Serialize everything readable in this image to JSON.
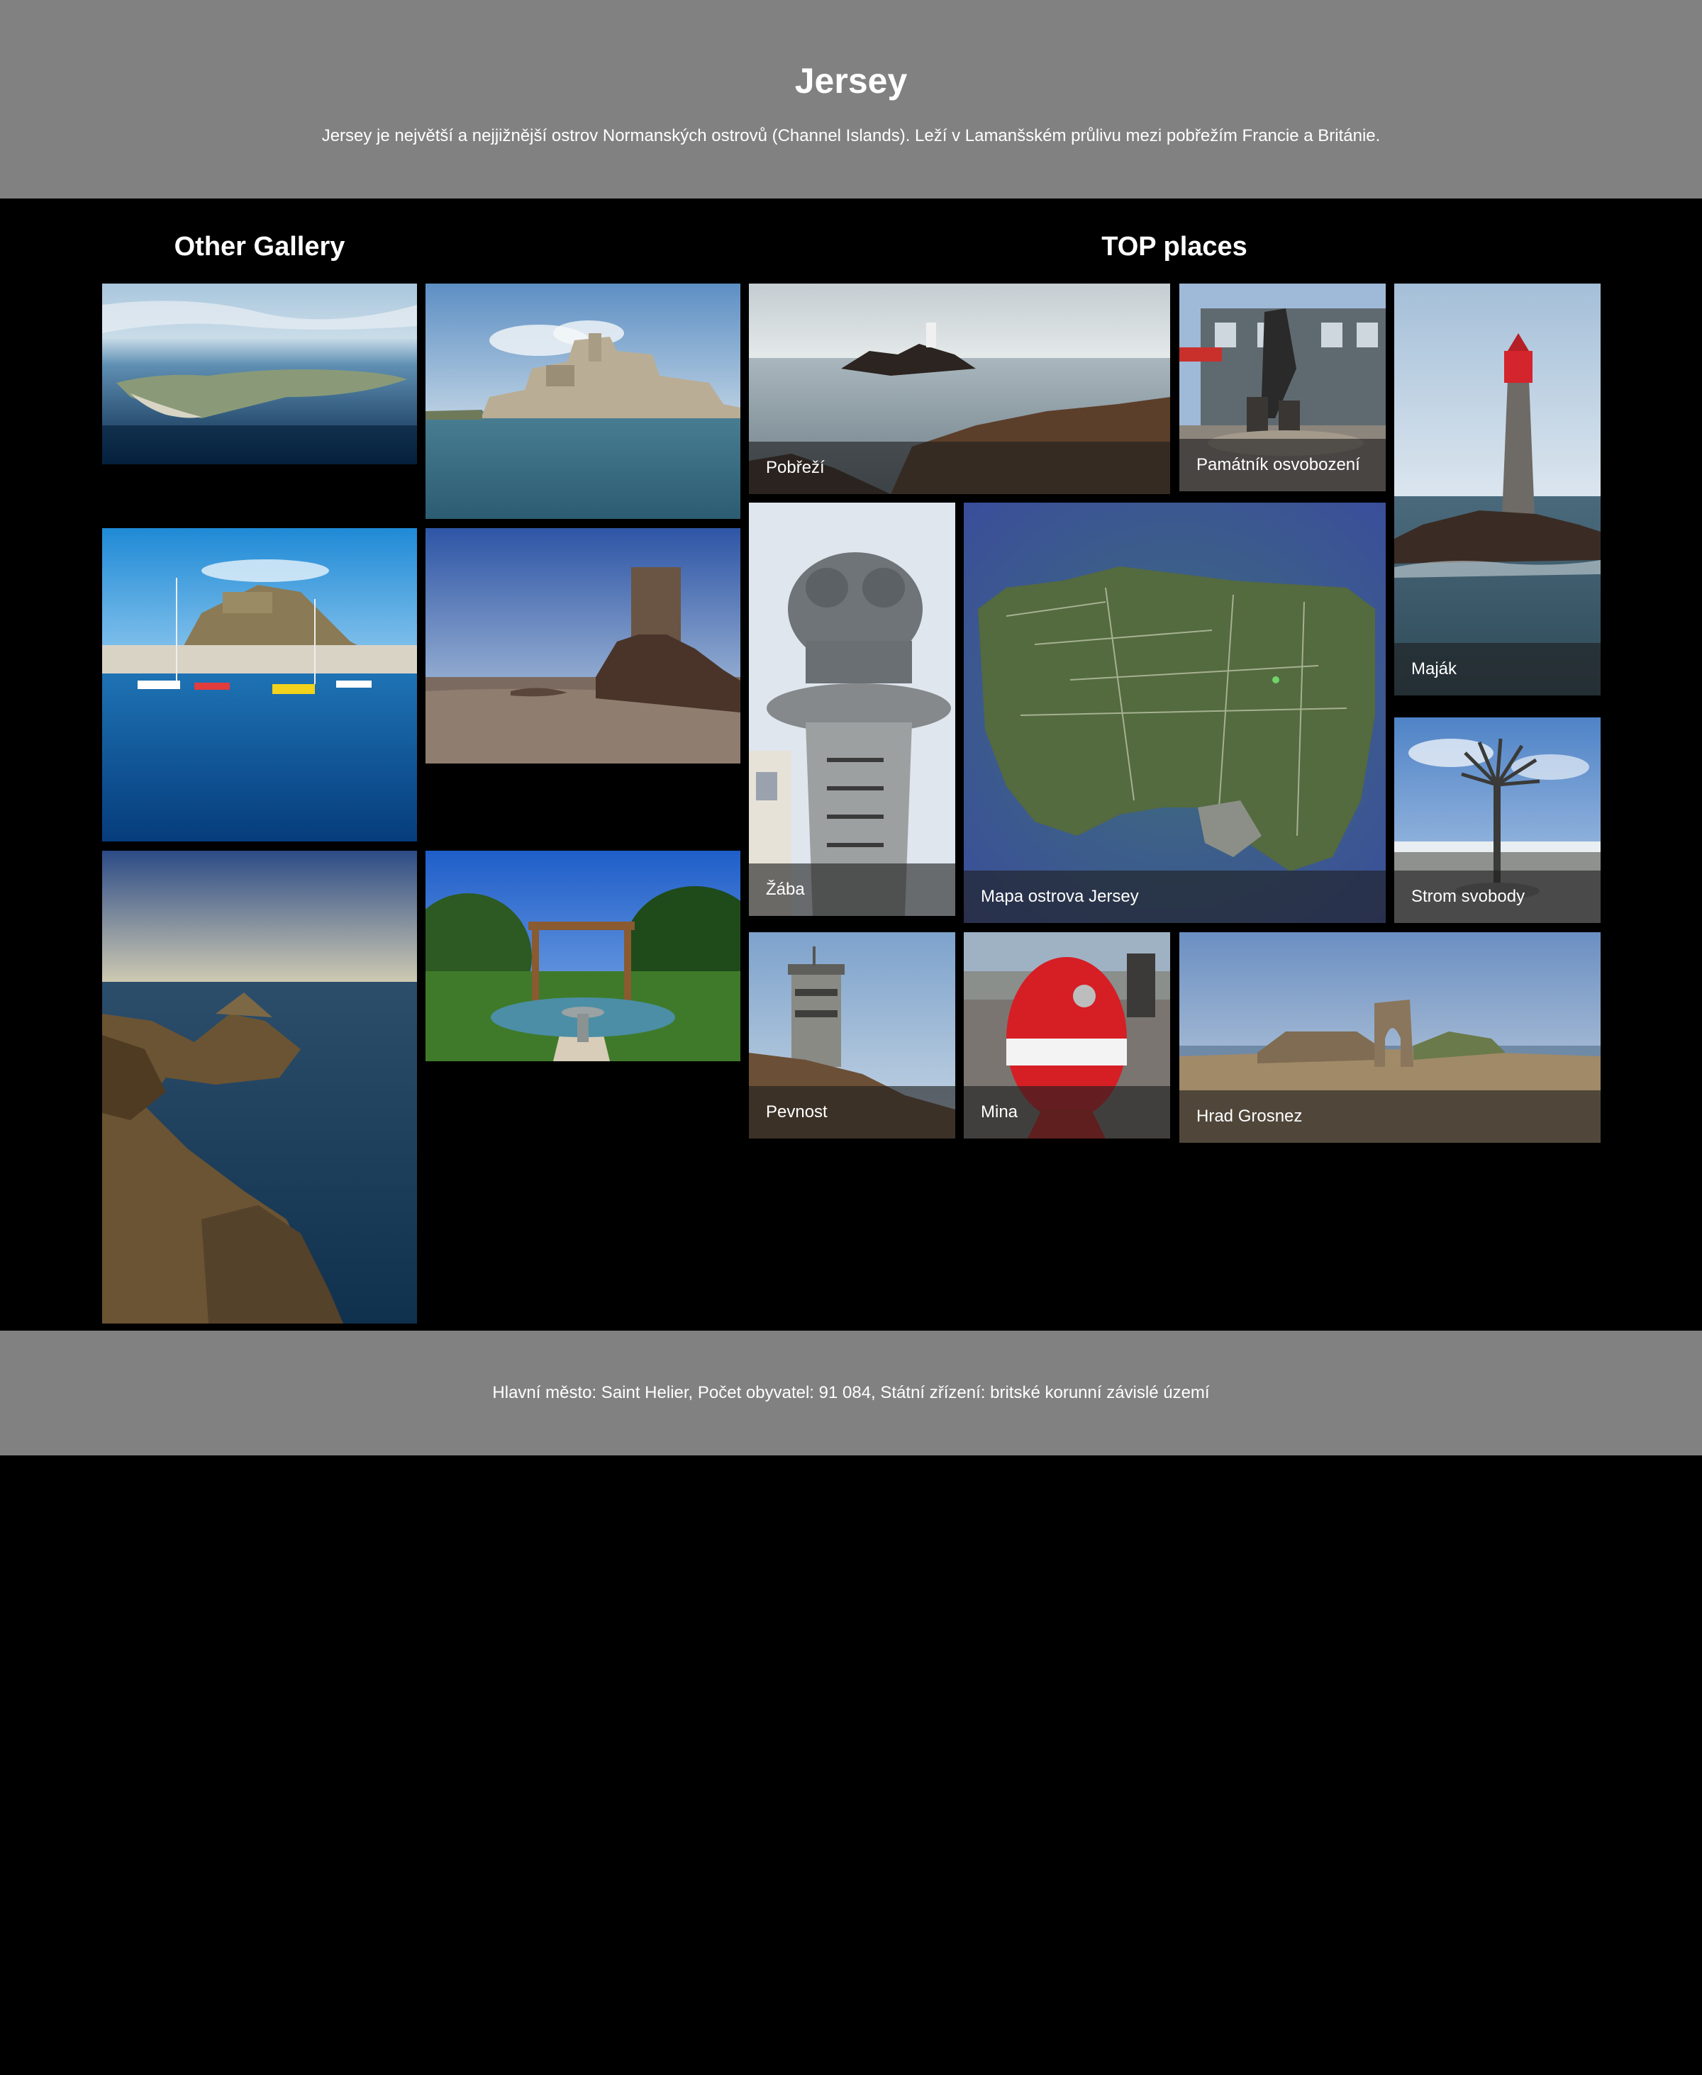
{
  "header": {
    "title": "Jersey",
    "description": "Jersey je největší a nejjižnější ostrov Normanských ostrovů (Channel Islands). Leží v Lamanšském průlivu mezi pobřežím Francie a Británie."
  },
  "other_gallery": {
    "title": "Other Gallery",
    "images": [
      {
        "subject": "aerial view of island"
      },
      {
        "subject": "sea castle"
      },
      {
        "subject": "harbour with castle"
      },
      {
        "subject": "tower on rocky shore"
      },
      {
        "subject": "coastal cliffs"
      },
      {
        "subject": "garden pergola and fountain"
      }
    ]
  },
  "top_places": {
    "title": "TOP places",
    "items": [
      {
        "caption": "Pobřeží"
      },
      {
        "caption": "Památník osvobození"
      },
      {
        "caption": "Maják"
      },
      {
        "caption": "Žába"
      },
      {
        "caption": "Mapa ostrova Jersey"
      },
      {
        "caption": "Strom svobody"
      },
      {
        "caption": "Pevnost"
      },
      {
        "caption": "Mina"
      },
      {
        "caption": "Hrad Grosnez"
      }
    ]
  },
  "footer": {
    "info": "Hlavní město: Saint Helier, Počet obyvatel: 91 084, Státní zřízení: britské korunní závislé území"
  }
}
